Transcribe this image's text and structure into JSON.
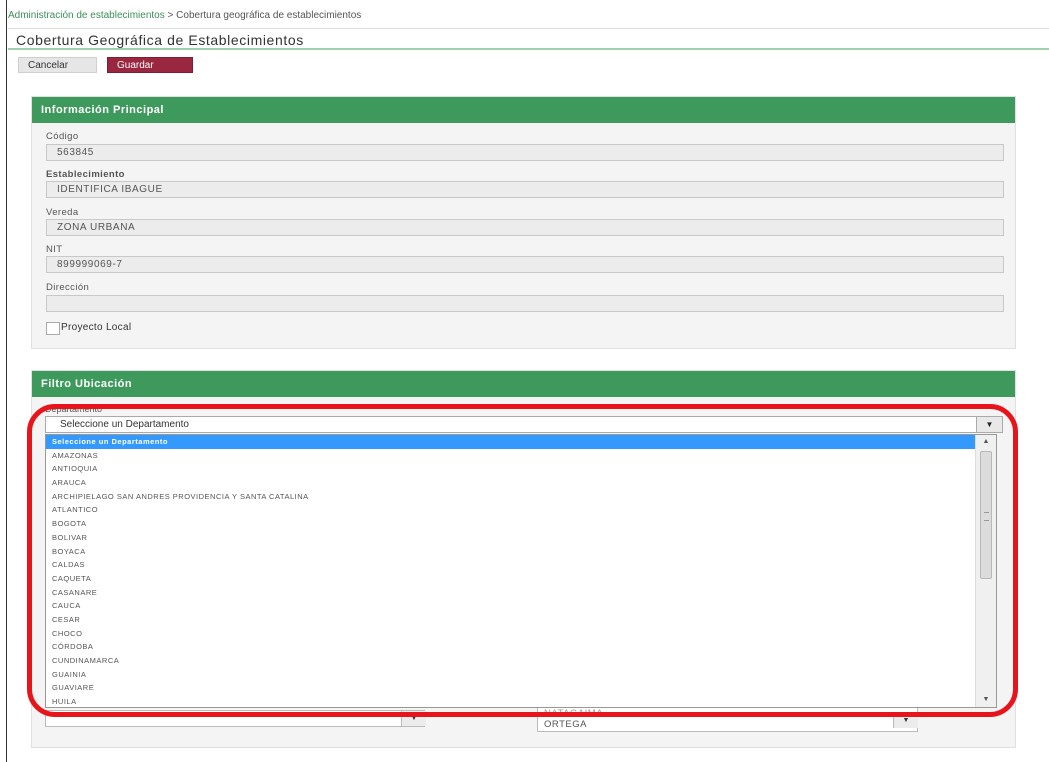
{
  "breadcrumb": {
    "parent": "Administración de establecimientos",
    "separator": ">",
    "current": "Cobertura geográfica de establecimientos"
  },
  "page_title": "Cobertura Geográfica de Establecimientos",
  "toolbar": {
    "cancel_label": "Cancelar",
    "save_label": "Guardar"
  },
  "info_panel": {
    "title": "Información Principal",
    "codigo_label": "Código",
    "codigo_value": "563845",
    "establecimiento_label": "Establecimiento",
    "establecimiento_value": "IDENTIFICA IBAGUE",
    "vereda_label": "Vereda",
    "vereda_value": "ZONA URBANA",
    "nit_label": "NIT",
    "nit_value": "899999069-7",
    "direccion_label": "Dirección",
    "direccion_value": "",
    "proyecto_label": "Proyecto Local",
    "proyecto_checked": false
  },
  "filter_panel": {
    "title": "Filtro Ubicación",
    "departamento_label": "Departamento",
    "departamento_selected": "Seleccione un Departamento",
    "options": [
      "Seleccione un Departamento",
      "AMAZONAS",
      "ANTIOQUIA",
      "ARAUCA",
      "ARCHIPIELAGO SAN ANDRES PROVIDENCIA Y SANTA CATALINA",
      "ATLANTICO",
      "BOGOTA",
      "BOLIVAR",
      "BOYACA",
      "CALDAS",
      "CAQUETA",
      "CASANARE",
      "CAUCA",
      "CESAR",
      "CHOCO",
      "CÓRDOBA",
      "CUNDINAMARCA",
      "GUAINIA",
      "GUAVIARE",
      "HUILA"
    ],
    "municipio_partial_top": "NATAGAIMA",
    "municipio_value": "ORTEGA"
  },
  "colors": {
    "accent_green": "#3e9a5c",
    "save_button": "#9a2740",
    "highlight_red": "#e8141c",
    "selected_option": "#3399ff"
  }
}
